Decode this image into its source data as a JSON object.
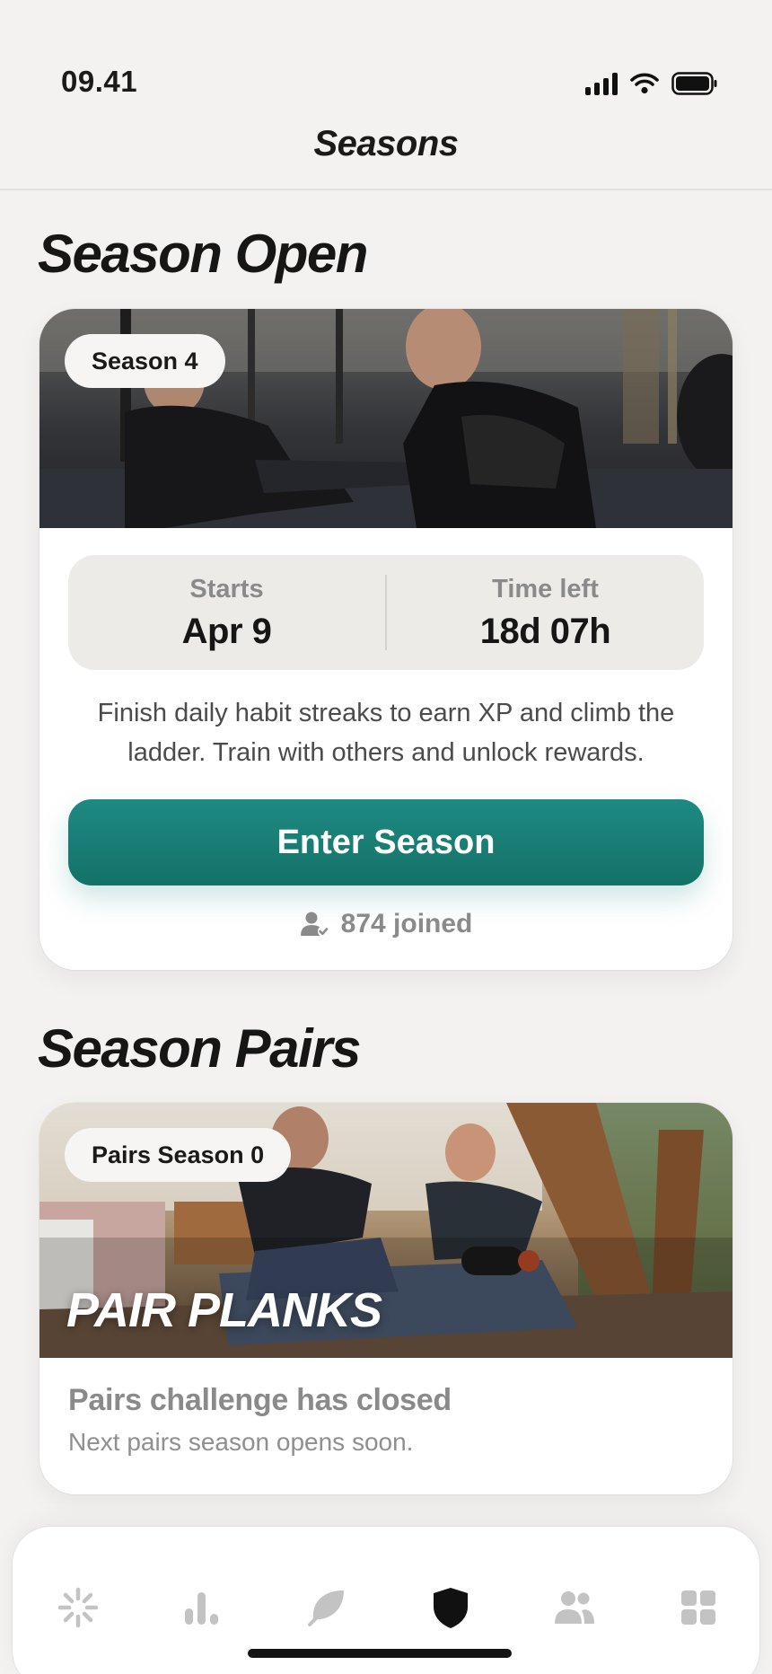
{
  "status_bar": {
    "time": "09.41"
  },
  "header": {
    "title": "Seasons"
  },
  "season_open": {
    "heading": "Season Open",
    "badge": "Season 4",
    "starts_label": "Starts",
    "starts_value": "Apr 9",
    "time_left_label": "Time left",
    "time_left_value": "18d 07h",
    "description": "Finish daily habit streaks to earn XP and climb the ladder. Train with others and unlock rewards.",
    "button_label": "Enter Season",
    "joined_text": "874 joined"
  },
  "season_pairs": {
    "heading": "Season Pairs",
    "badge": "Pairs Season 0",
    "hero_title": "PAIR PLANKS",
    "closed_title": "Pairs challenge has closed",
    "closed_subtitle": "Next pairs season opens soon."
  },
  "tab_bar": {
    "tabs": [
      {
        "icon": "sparkle-icon",
        "active": false
      },
      {
        "icon": "bar-chart-icon",
        "active": false
      },
      {
        "icon": "leaf-icon",
        "active": false
      },
      {
        "icon": "shield-icon",
        "active": true
      },
      {
        "icon": "people-icon",
        "active": false
      },
      {
        "icon": "grid-icon",
        "active": false
      }
    ]
  },
  "colors": {
    "accent": "#1a7f77",
    "background": "#f3f2f0",
    "muted_text": "#8a8a8a",
    "tab_inactive": "#c3c3c3",
    "tab_active": "#111111"
  }
}
